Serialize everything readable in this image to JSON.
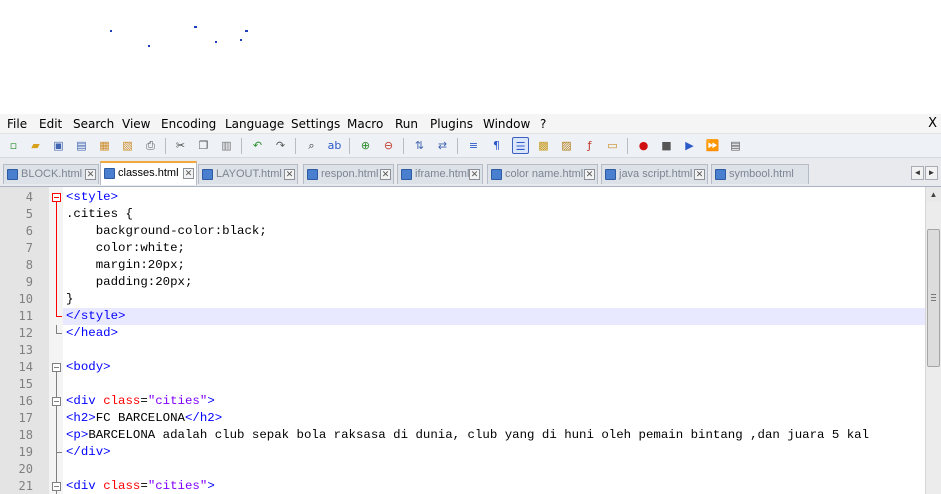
{
  "menu": {
    "items": [
      "File",
      "Edit",
      "Search",
      "View",
      "Encoding",
      "Language",
      "Settings",
      "Macro",
      "Run",
      "Plugins",
      "Window",
      "?"
    ],
    "close_label": "X"
  },
  "toolbar": {
    "icons": [
      "new-file-icon",
      "open-file-icon",
      "save-icon",
      "save-all-icon",
      "close-icon",
      "close-all-icon",
      "print-icon",
      "cut-icon",
      "copy-icon",
      "paste-icon",
      "undo-icon",
      "redo-icon",
      "find-icon",
      "replace-icon",
      "zoom-in-icon",
      "zoom-out-icon",
      "sync-vertical-icon",
      "sync-horizontal-icon",
      "word-wrap-icon",
      "show-all-chars-icon",
      "indent-guide-icon",
      "doc-map-icon",
      "function-list-icon",
      "folder-workspace-icon",
      "monitoring-icon",
      "record-macro-icon",
      "stop-record-icon",
      "play-macro-icon",
      "run-macro-multiple-icon",
      "save-macro-icon"
    ]
  },
  "tabs": [
    {
      "label": "BLOCK.html",
      "active": false
    },
    {
      "label": "classes.html",
      "active": true
    },
    {
      "label": "LAYOUT.html",
      "active": false
    },
    {
      "label": "respon.html",
      "active": false
    },
    {
      "label": "iframe.html",
      "active": false
    },
    {
      "label": "color name.html",
      "active": false
    },
    {
      "label": "java script.html",
      "active": false
    },
    {
      "label": "symbool.html",
      "active": false
    }
  ],
  "tab_scroll": {
    "left": "◄",
    "right": "►"
  },
  "editor": {
    "highlighted_line": 11,
    "lines": [
      {
        "n": "4",
        "segs": [
          [
            "tag",
            "<style>"
          ]
        ]
      },
      {
        "n": "5",
        "segs": [
          [
            "plain",
            ".cities {"
          ]
        ]
      },
      {
        "n": "6",
        "segs": [
          [
            "plain",
            "    background-color:black;"
          ]
        ]
      },
      {
        "n": "7",
        "segs": [
          [
            "plain",
            "    color:white;"
          ]
        ]
      },
      {
        "n": "8",
        "segs": [
          [
            "plain",
            "    margin:20px;"
          ]
        ]
      },
      {
        "n": "9",
        "segs": [
          [
            "plain",
            "    padding:20px;"
          ]
        ]
      },
      {
        "n": "10",
        "segs": [
          [
            "plain",
            "}"
          ]
        ]
      },
      {
        "n": "11",
        "segs": [
          [
            "tag",
            "</style>"
          ]
        ]
      },
      {
        "n": "12",
        "segs": [
          [
            "tag",
            "</head>"
          ]
        ]
      },
      {
        "n": "13",
        "segs": []
      },
      {
        "n": "14",
        "segs": [
          [
            "tag",
            "<body>"
          ]
        ]
      },
      {
        "n": "15",
        "segs": []
      },
      {
        "n": "16",
        "segs": [
          [
            "tag",
            "<div "
          ],
          [
            "attr",
            "class"
          ],
          [
            "plain",
            "="
          ],
          [
            "str",
            "\"cities\""
          ],
          [
            "tag",
            ">"
          ]
        ]
      },
      {
        "n": "17",
        "segs": [
          [
            "tag",
            "<h2>"
          ],
          [
            "plain",
            "FC BARCELONA"
          ],
          [
            "tag",
            "</h2>"
          ]
        ]
      },
      {
        "n": "18",
        "segs": [
          [
            "tag",
            "<p>"
          ],
          [
            "plain",
            "BARCELONA adalah club sepak bola raksasa di dunia, club yang di huni oleh pemain bintang ,dan juara 5 kal"
          ]
        ]
      },
      {
        "n": "19",
        "segs": [
          [
            "tag",
            "</div>"
          ]
        ]
      },
      {
        "n": "20",
        "segs": []
      },
      {
        "n": "21",
        "segs": [
          [
            "tag",
            "<div "
          ],
          [
            "attr",
            "class"
          ],
          [
            "plain",
            "="
          ],
          [
            "str",
            "\"cities\""
          ],
          [
            "tag",
            ">"
          ]
        ]
      }
    ]
  },
  "colors": {
    "tag": "#0000ff",
    "attribute": "#ff0000",
    "string": "#8000ff",
    "active_tab_accent": "#f2a93b",
    "current_line": "#e8e8ff"
  }
}
